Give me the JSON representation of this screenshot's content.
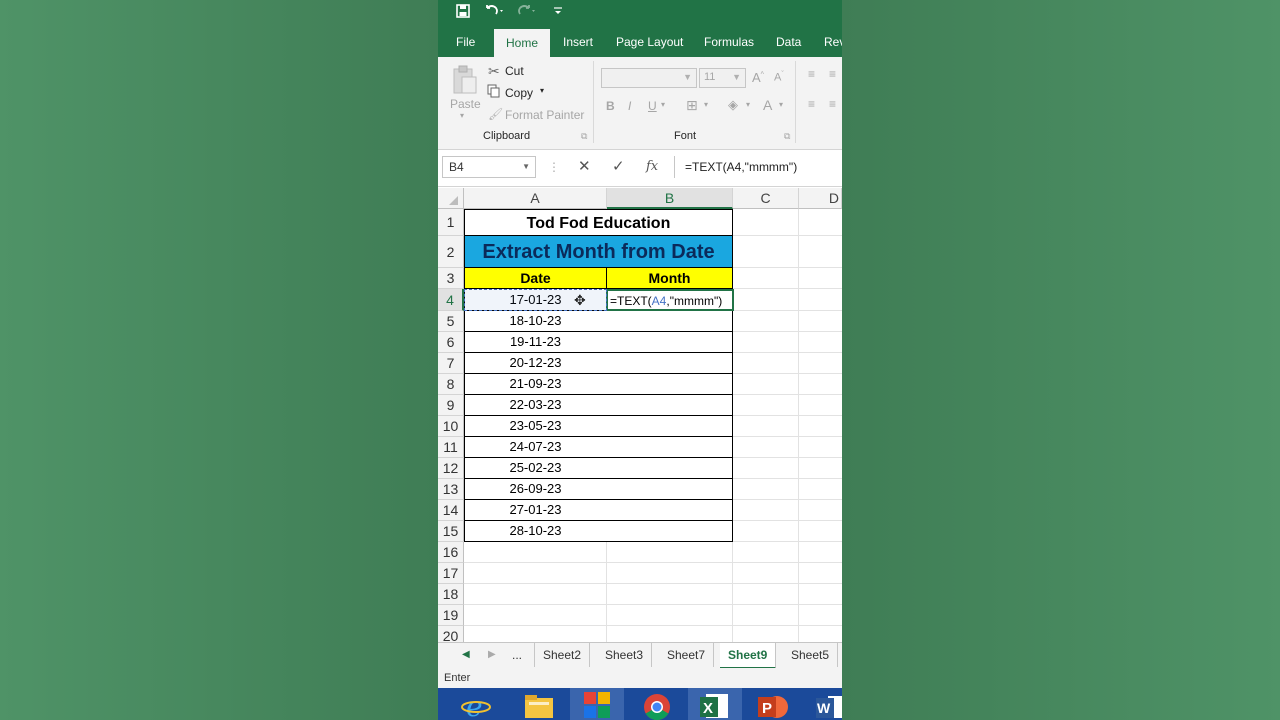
{
  "quick_access": {
    "save_icon": "save-icon",
    "undo_icon": "undo-icon",
    "redo_icon": "redo-icon",
    "customize_icon": "dropdown-arrow-icon"
  },
  "ribbon_tabs": [
    "File",
    "Home",
    "Insert",
    "Page Layout",
    "Formulas",
    "Data",
    "Rev"
  ],
  "active_tab": "Home",
  "clipboard": {
    "paste": "Paste",
    "cut": "Cut",
    "copy": "Copy",
    "format_painter": "Format Painter",
    "group_label": "Clipboard"
  },
  "font_group": {
    "font_name": "",
    "font_size": "11",
    "bold": "B",
    "italic": "I",
    "underline": "U",
    "group_label": "Font"
  },
  "formula_bar": {
    "name_box": "B4",
    "cancel": "✕",
    "enter": "✓",
    "fx": "fx",
    "formula": "=TEXT(A4,\"mmmm\")"
  },
  "columns": [
    "A",
    "B",
    "C",
    "D"
  ],
  "sheet": {
    "title": "Tod Fod Education",
    "subtitle": "Extract Month from Date",
    "header_date": "Date",
    "header_month": "Month",
    "editing_formula_prefix": "=TEXT(",
    "editing_formula_ref": "A4",
    "editing_formula_suffix": ",\"mmmm\")",
    "dates": [
      "17-01-23",
      "18-10-23",
      "19-11-23",
      "20-12-23",
      "21-09-23",
      "22-03-23",
      "23-05-23",
      "24-07-23",
      "25-02-23",
      "26-09-23",
      "27-01-23",
      "28-10-23"
    ]
  },
  "row_numbers": [
    "1",
    "2",
    "3",
    "4",
    "5",
    "6",
    "7",
    "8",
    "9",
    "10",
    "11",
    "12",
    "13",
    "14",
    "15",
    "16",
    "17",
    "18",
    "19",
    "20"
  ],
  "sheet_tabs": [
    "...",
    "Sheet2",
    "Sheet3",
    "Sheet7",
    "Sheet9",
    "Sheet5"
  ],
  "active_sheet": "Sheet9",
  "status": "Enter",
  "taskbar_apps": [
    "internet-explorer-icon",
    "file-explorer-icon",
    "office-apps-icon",
    "chrome-icon",
    "excel-icon",
    "powerpoint-icon",
    "word-icon"
  ],
  "colors": {
    "excel_green": "#217346",
    "title_blue": "#1aa7e0",
    "header_yellow": "#ffff00",
    "ref_blue": "#4472c4"
  }
}
